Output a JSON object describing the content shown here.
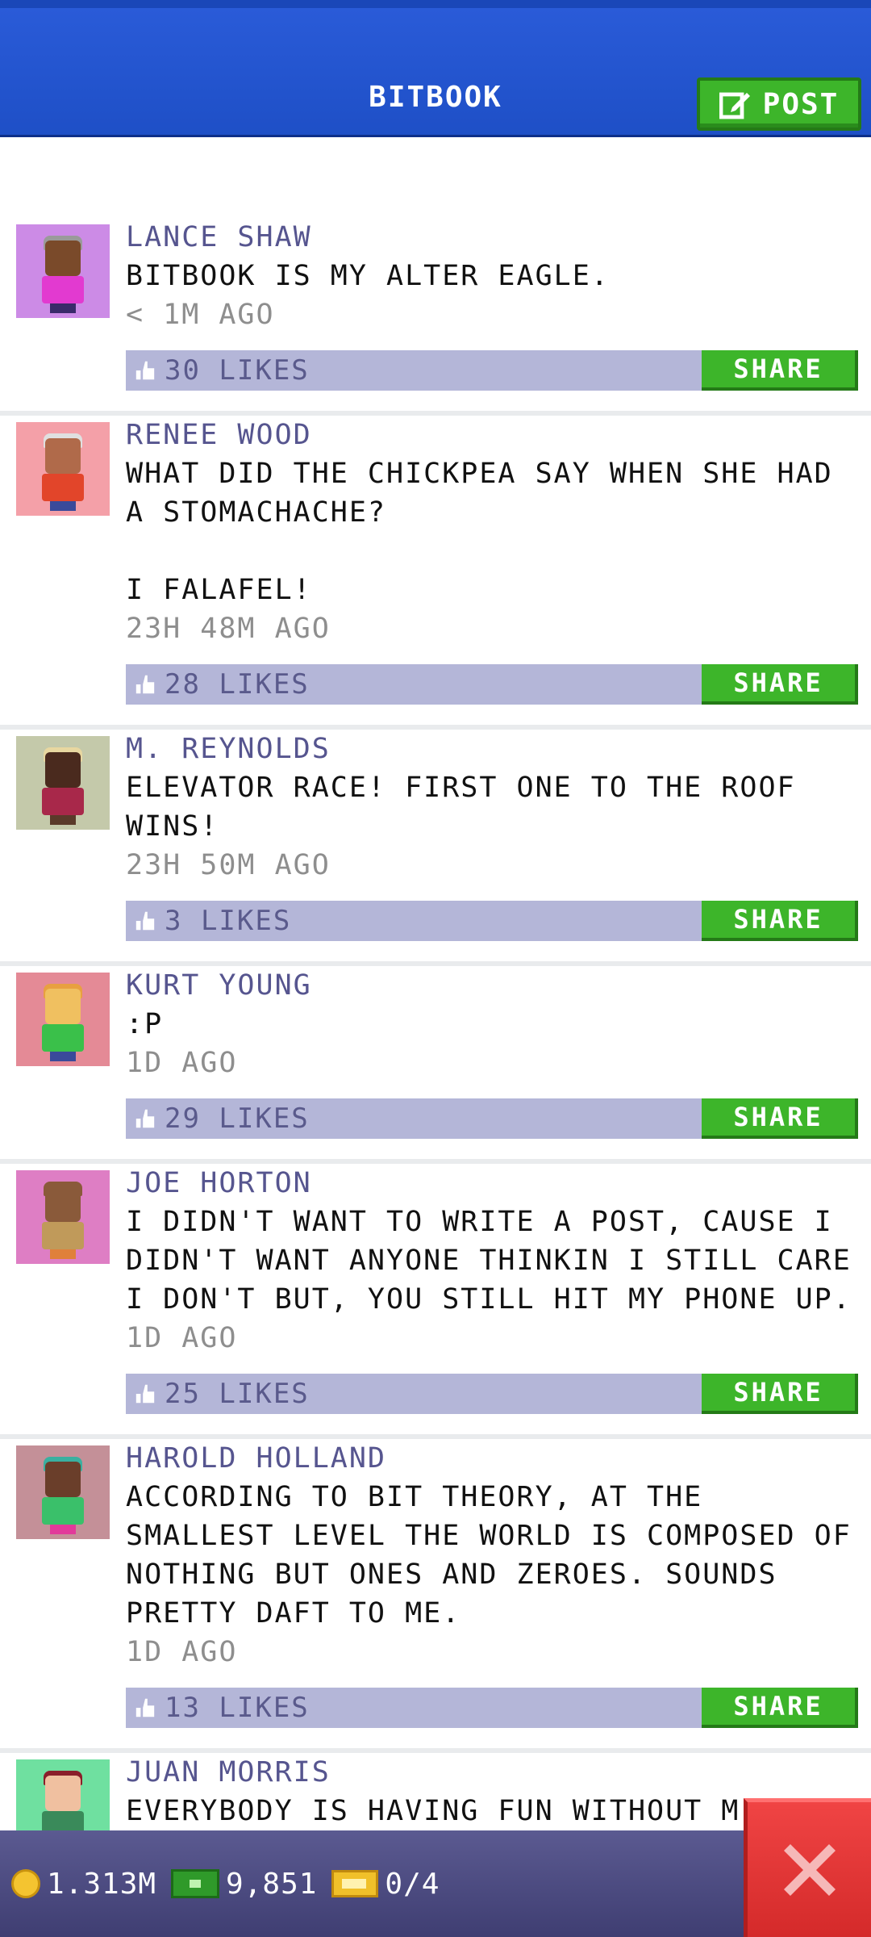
{
  "header": {
    "title": "BITBOOK",
    "post_label": "POST"
  },
  "posts": [
    {
      "name": "LANCE SHAW",
      "text": "BITBOOK IS MY ALTER EAGLE.",
      "time": "< 1M AGO",
      "likes": "30 LIKES",
      "share": "SHARE",
      "avatar_bg": "#cc8be6",
      "skin": "#7a4a2a",
      "hair": "#9a9a9a",
      "shirt": "#e23ad0"
    },
    {
      "name": "RENEE WOOD",
      "text": "WHAT DID THE CHICKPEA SAY WHEN SHE HAD A STOMACHACHE?\n\nI FALAFEL!",
      "time": "23H 48M AGO",
      "likes": "28 LIKES",
      "share": "SHARE",
      "avatar_bg": "#f4a0a8",
      "skin": "#b06a4a",
      "hair": "#e0e0e0",
      "shirt": "#e2452a"
    },
    {
      "name": "M. REYNOLDS",
      "text": "ELEVATOR RACE! FIRST ONE TO THE ROOF WINS!",
      "time": "23H 50M AGO",
      "likes": "3 LIKES",
      "share": "SHARE",
      "avatar_bg": "#c4c9aa",
      "skin": "#4a2a1e",
      "hair": "#e8d7a0",
      "shirt": "#a8284a"
    },
    {
      "name": "KURT YOUNG",
      "text": ":P",
      "time": "1D AGO",
      "likes": "29 LIKES",
      "share": "SHARE",
      "avatar_bg": "#e48a96",
      "skin": "#f0c060",
      "hair": "#e8a040",
      "shirt": "#3ac04a"
    },
    {
      "name": "JOE HORTON",
      "text": "I DIDN'T WANT TO WRITE A POST, CAUSE I DIDN'T WANT ANYONE THINKIN I STILL CARE I DON'T BUT, YOU STILL HIT MY PHONE UP.",
      "time": "1D AGO",
      "likes": "25 LIKES",
      "share": "SHARE",
      "avatar_bg": "#de7ec4",
      "skin": "#8a5a3a",
      "hair": "#8a5a3a",
      "shirt": "#c09a5a"
    },
    {
      "name": "HAROLD HOLLAND",
      "text": "ACCORDING TO BIT THEORY, AT THE SMALLEST LEVEL THE WORLD IS COMPOSED OF NOTHING BUT ONES AND ZEROES. SOUNDS PRETTY DAFT TO ME.",
      "time": "1D AGO",
      "likes": "13 LIKES",
      "share": "SHARE",
      "avatar_bg": "#c49098",
      "skin": "#6a3e2a",
      "hair": "#3ab0a0",
      "shirt": "#3ac06a"
    },
    {
      "name": "JUAN MORRIS",
      "text": "EVERYBODY IS HAVING FUN WITHOUT M",
      "time": "",
      "likes": "",
      "share": "",
      "avatar_bg": "#6fe0a0",
      "skin": "#f0c0a0",
      "hair": "#8a1e2a",
      "shirt": "#3a8a5a"
    }
  ],
  "bottom": {
    "coins": "1.313M",
    "bux": "9,851",
    "tickets": "0/4"
  },
  "colors": {
    "header_blue": "#2a5bd8",
    "share_green": "#3db52a",
    "likes_bar": "#b4b6d8",
    "name_purple": "#56558f",
    "close_red": "#e03434"
  }
}
